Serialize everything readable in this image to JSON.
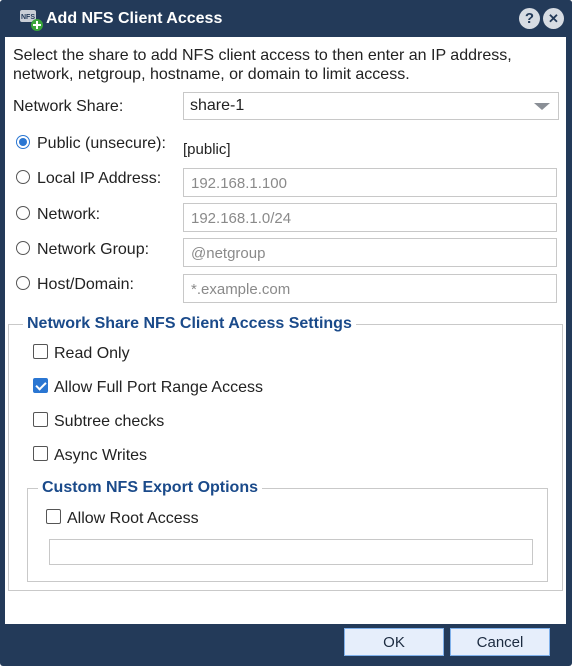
{
  "dialog": {
    "title": "Add NFS Client Access",
    "icons": {
      "app": "nfs-add-icon",
      "help": "help-icon",
      "close": "close-icon"
    },
    "help_glyph": "?",
    "close_glyph": "✕"
  },
  "intro": "Select the share to add NFS client access to then enter an IP address, network, netgroup, hostname, or domain to limit access.",
  "share": {
    "label": "Network Share:",
    "value": "share-1"
  },
  "access": {
    "public": {
      "label": "Public (unsecure):",
      "value": "[public]",
      "selected": true
    },
    "local_ip": {
      "label": "Local IP Address:",
      "placeholder": "192.168.1.100"
    },
    "network": {
      "label": "Network:",
      "placeholder": "192.168.1.0/24"
    },
    "group": {
      "label": "Network Group:",
      "placeholder": "@netgroup"
    },
    "host": {
      "label": "Host/Domain:",
      "placeholder": "*.example.com"
    }
  },
  "settings": {
    "title": "Network Share NFS Client Access Settings",
    "read_only": {
      "label": "Read Only",
      "checked": false
    },
    "full_port": {
      "label": "Allow Full Port Range Access",
      "checked": true
    },
    "subtree": {
      "label": "Subtree checks",
      "checked": false
    },
    "async": {
      "label": "Async Writes",
      "checked": false
    }
  },
  "custom": {
    "title": "Custom NFS Export Options",
    "root_access": {
      "label": "Allow Root Access",
      "checked": false
    },
    "options_value": ""
  },
  "buttons": {
    "ok": "OK",
    "cancel": "Cancel"
  },
  "colors": {
    "titlebar": "#233a59",
    "accent": "#2a76d2",
    "legend": "#1a4a8a"
  }
}
